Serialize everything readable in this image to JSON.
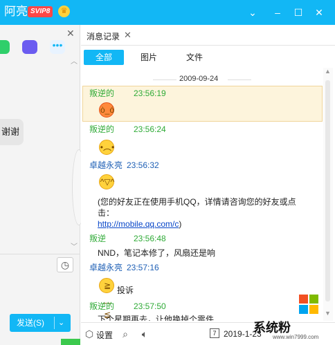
{
  "window": {
    "title": "阿亮",
    "vip_badge": "SVIP8",
    "crown_icon": "crown-icon"
  },
  "left": {
    "bubble_text": "谢谢",
    "send_label": "发送(S)"
  },
  "records": {
    "tab_label": "消息记录",
    "filters": [
      "全部",
      "图片",
      "文件"
    ],
    "date_separator": "2009-09-24",
    "messages": [
      {
        "sender": "叛逆的",
        "time": "23:56:19",
        "emoji": "angry-face-icon"
      },
      {
        "sender": "叛逆的",
        "time": "23:56:24",
        "emoji": "sad-face-icon"
      },
      {
        "sender": "卓越永亮",
        "time": "23:56:32",
        "emoji": "grin-face-icon",
        "text_line1": "(您的好友正在使用手机QQ，详情请咨询您的好友或点",
        "text_line2": "击：",
        "link": "http://mobile.qq.com/c",
        "link_suffix": ")"
      },
      {
        "sender": "叛逆",
        "time": "23:56:48",
        "text": "NND，笔记本修了，风扇还是响"
      },
      {
        "sender": "卓越永亮",
        "time": "23:57:16",
        "emoji": "embarrassed-face-icon",
        "text": "投诉"
      },
      {
        "sender": "叛逆的",
        "time": "23:57:50",
        "text": "下个星期再去，让他换掉个零件"
      }
    ]
  },
  "bottom": {
    "settings_label": "设置",
    "date_value": "2019-1-23"
  },
  "watermark": {
    "text": "系统粉",
    "url": "www.win7999.com"
  },
  "colors": {
    "accent": "#12b7f5",
    "vip": "#ff4747",
    "green_name": "#2eaa36",
    "blue_name": "#1e5fb5",
    "highlight": "#fdf4dc"
  }
}
